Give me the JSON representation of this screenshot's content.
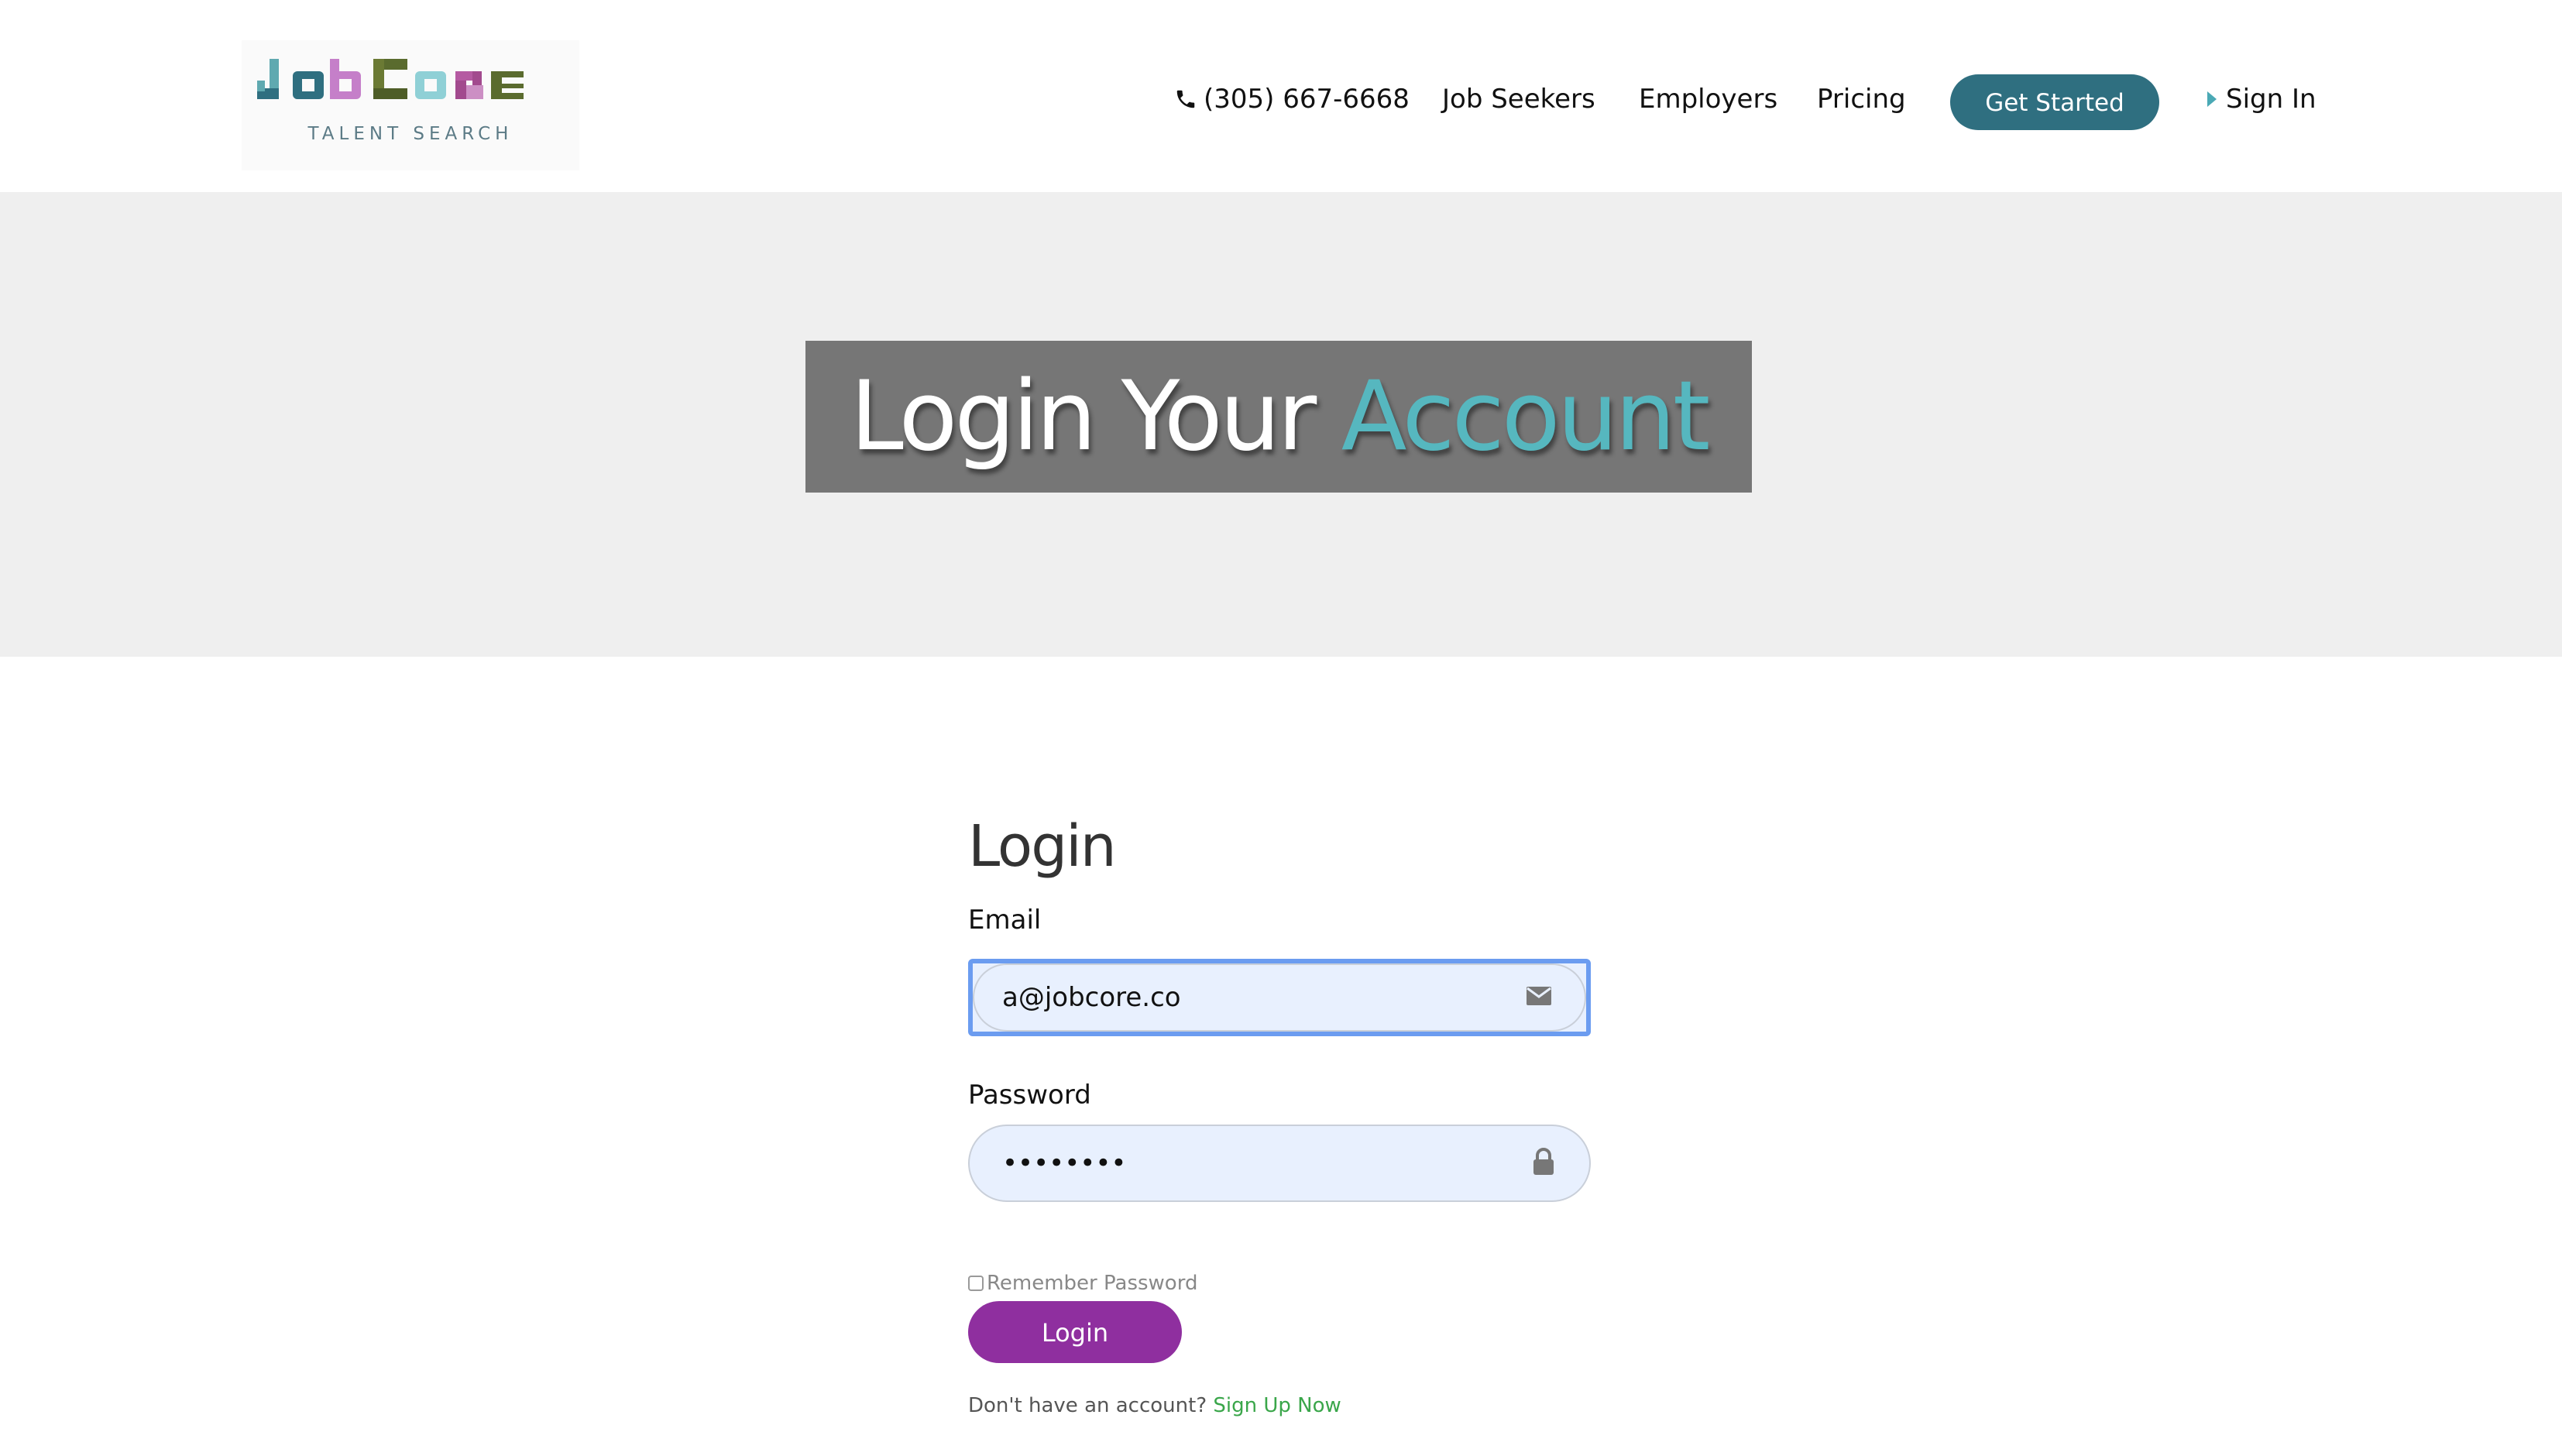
{
  "header": {
    "logo": {
      "wordmark": "JobCore",
      "tagline": "TALENT SEARCH"
    },
    "nav": {
      "phone": "(305) 667-6668",
      "job_seekers": "Job Seekers",
      "employers": "Employers",
      "pricing": "Pricing",
      "get_started": "Get Started",
      "sign_in": "Sign In"
    }
  },
  "hero": {
    "title_main": "Login Your ",
    "title_accent": "Account"
  },
  "form": {
    "title": "Login",
    "email": {
      "label": "Email",
      "value": "a@jobcore.co",
      "icon": "envelope-icon"
    },
    "password": {
      "label": "Password",
      "value": "••••••••",
      "icon": "lock-icon"
    },
    "remember_label": "Remember Password",
    "login_button": "Login",
    "signup_prompt": "Don't have an account? ",
    "signup_link": "Sign Up Now"
  },
  "colors": {
    "primary_teal": "#2f6f80",
    "accent_teal": "#56b7bf",
    "login_purple": "#8f2f9f",
    "link_green": "#3aa64a",
    "hero_bg": "#efefef",
    "hero_box": "#767676",
    "input_bg": "#e8f0fe",
    "focus_blue": "#6b9cf0"
  }
}
